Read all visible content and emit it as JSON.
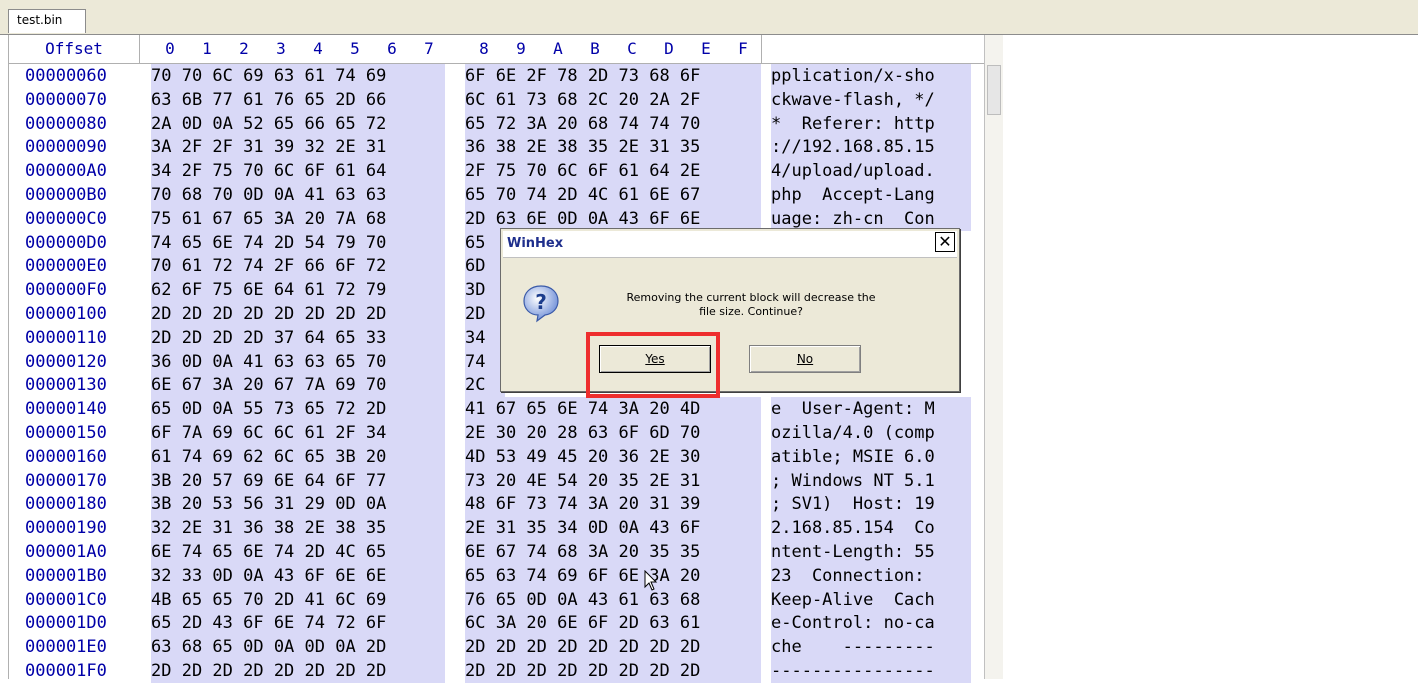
{
  "tab": {
    "label": "test.bin"
  },
  "header": {
    "offset_label": "Offset",
    "hex_columns": [
      "0",
      "1",
      "2",
      "3",
      "4",
      "5",
      "6",
      "7",
      "8",
      "9",
      "A",
      "B",
      "C",
      "D",
      "E",
      "F"
    ]
  },
  "rows": [
    {
      "offset": "00000060",
      "hexA": "70 70 6C 69 63 61 74 69",
      "hexB": "6F 6E 2F 78 2D 73 68 6F",
      "ascii": "pplication/x-sho"
    },
    {
      "offset": "00000070",
      "hexA": "63 6B 77 61 76 65 2D 66",
      "hexB": "6C 61 73 68 2C 20 2A 2F",
      "ascii": "ckwave-flash, */"
    },
    {
      "offset": "00000080",
      "hexA": "2A 0D 0A 52 65 66 65 72",
      "hexB": "65 72 3A 20 68 74 74 70",
      "ascii": "*  Referer: http"
    },
    {
      "offset": "00000090",
      "hexA": "3A 2F 2F 31 39 32 2E 31",
      "hexB": "36 38 2E 38 35 2E 31 35",
      "ascii": "://192.168.85.15"
    },
    {
      "offset": "000000A0",
      "hexA": "34 2F 75 70 6C 6F 61 64",
      "hexB": "2F 75 70 6C 6F 61 64 2E",
      "ascii": "4/upload/upload."
    },
    {
      "offset": "000000B0",
      "hexA": "70 68 70 0D 0A 41 63 63",
      "hexB": "65 70 74 2D 4C 61 6E 67",
      "ascii": "php  Accept-Lang"
    },
    {
      "offset": "000000C0",
      "hexA": "75 61 67 65 3A 20 7A 68",
      "hexB": "2D 63 6E 0D 0A 43 6F 6E",
      "ascii": "uage: zh-cn  Con"
    },
    {
      "offset": "000000D0",
      "hexA": "74 65 6E 74 2D 54 79 70",
      "hexB": "65",
      "ascii": ""
    },
    {
      "offset": "000000E0",
      "hexA": "70 61 72 74 2F 66 6F 72",
      "hexB": "6D",
      "ascii": ""
    },
    {
      "offset": "000000F0",
      "hexA": "62 6F 75 6E 64 61 72 79",
      "hexB": "3D",
      "ascii": ""
    },
    {
      "offset": "00000100",
      "hexA": "2D 2D 2D 2D 2D 2D 2D 2D",
      "hexB": "2D",
      "ascii": ""
    },
    {
      "offset": "00000110",
      "hexA": "2D 2D 2D 2D 37 64 65 33",
      "hexB": "34",
      "ascii": ""
    },
    {
      "offset": "00000120",
      "hexA": "36 0D 0A 41 63 63 65 70",
      "hexB": "74",
      "ascii": ""
    },
    {
      "offset": "00000130",
      "hexA": "6E 67 3A 20 67 7A 69 70",
      "hexB": "2C",
      "ascii": ""
    },
    {
      "offset": "00000140",
      "hexA": "65 0D 0A 55 73 65 72 2D",
      "hexB": "41 67 65 6E 74 3A 20 4D",
      "ascii": "e  User-Agent: M"
    },
    {
      "offset": "00000150",
      "hexA": "6F 7A 69 6C 6C 61 2F 34",
      "hexB": "2E 30 20 28 63 6F 6D 70",
      "ascii": "ozilla/4.0 (comp"
    },
    {
      "offset": "00000160",
      "hexA": "61 74 69 62 6C 65 3B 20",
      "hexB": "4D 53 49 45 20 36 2E 30",
      "ascii": "atible; MSIE 6.0"
    },
    {
      "offset": "00000170",
      "hexA": "3B 20 57 69 6E 64 6F 77",
      "hexB": "73 20 4E 54 20 35 2E 31",
      "ascii": "; Windows NT 5.1"
    },
    {
      "offset": "00000180",
      "hexA": "3B 20 53 56 31 29 0D 0A",
      "hexB": "48 6F 73 74 3A 20 31 39",
      "ascii": "; SV1)  Host: 19"
    },
    {
      "offset": "00000190",
      "hexA": "32 2E 31 36 38 2E 38 35",
      "hexB": "2E 31 35 34 0D 0A 43 6F",
      "ascii": "2.168.85.154  Co"
    },
    {
      "offset": "000001A0",
      "hexA": "6E 74 65 6E 74 2D 4C 65",
      "hexB": "6E 67 74 68 3A 20 35 35",
      "ascii": "ntent-Length: 55"
    },
    {
      "offset": "000001B0",
      "hexA": "32 33 0D 0A 43 6F 6E 6E",
      "hexB": "65 63 74 69 6F 6E 3A 20",
      "ascii": "23  Connection: "
    },
    {
      "offset": "000001C0",
      "hexA": "4B 65 65 70 2D 41 6C 69",
      "hexB": "76 65 0D 0A 43 61 63 68",
      "ascii": "Keep-Alive  Cach"
    },
    {
      "offset": "000001D0",
      "hexA": "65 2D 43 6F 6E 74 72 6F",
      "hexB": "6C 3A 20 6E 6F 2D 63 61",
      "ascii": "e-Control: no-ca"
    },
    {
      "offset": "000001E0",
      "hexA": "63 68 65 0D 0A 0D 0A 2D",
      "hexB": "2D 2D 2D 2D 2D 2D 2D 2D",
      "ascii": "che    ---------"
    },
    {
      "offset": "000001F0",
      "hexA": "2D 2D 2D 2D 2D 2D 2D 2D",
      "hexB": "2D 2D 2D 2D 2D 2D 2D 2D",
      "ascii": "----------------"
    }
  ],
  "dialog": {
    "title": "WinHex",
    "close_glyph": "✕",
    "message_line1": "Removing the current block will decrease the",
    "message_line2": "file size. Continue?",
    "yes_label": "Yes",
    "no_label": "No"
  },
  "colors": {
    "highlight": "#ee2e2e",
    "offset_text": "#0000a8",
    "selection_bg": "#d9d9f7"
  }
}
